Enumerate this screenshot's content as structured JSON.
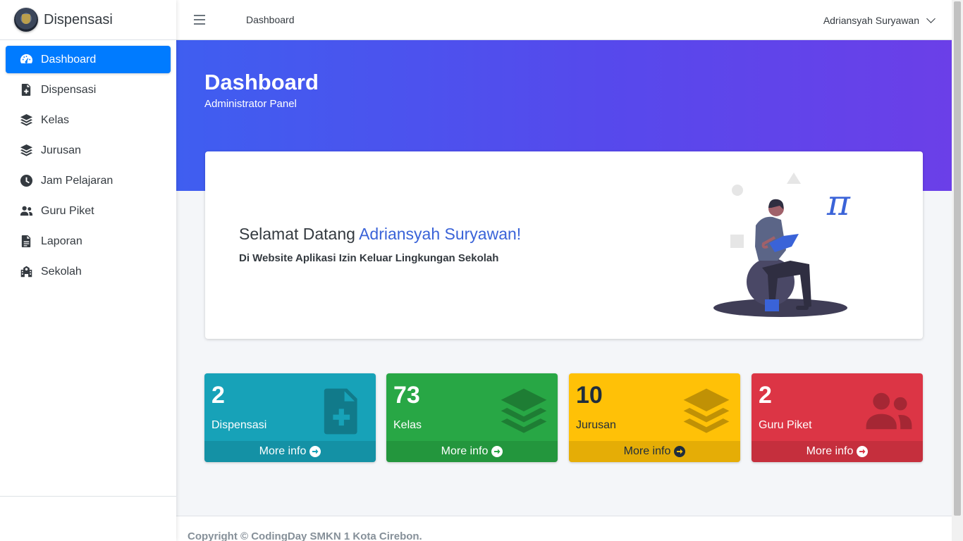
{
  "brand": {
    "name": "Dispensasi"
  },
  "sidebar": {
    "items": [
      {
        "label": "Dashboard",
        "icon": "tachometer-icon",
        "active": true
      },
      {
        "label": "Dispensasi",
        "icon": "file-medical-icon"
      },
      {
        "label": "Kelas",
        "icon": "layer-group-icon"
      },
      {
        "label": "Jurusan",
        "icon": "layer-group-icon"
      },
      {
        "label": "Jam Pelajaran",
        "icon": "clock-icon"
      },
      {
        "label": "Guru Piket",
        "icon": "users-icon"
      },
      {
        "label": "Laporan",
        "icon": "file-alt-icon"
      },
      {
        "label": "Sekolah",
        "icon": "school-icon"
      }
    ]
  },
  "header": {
    "title": "Dashboard",
    "user": "Adriansyah Suryawan"
  },
  "hero": {
    "title": "Dashboard",
    "subtitle": "Administrator Panel"
  },
  "welcome": {
    "greeting": "Selamat Datang",
    "name": "Adriansyah Suryawan!",
    "subtitle": "Di Website Aplikasi Izin Keluar Lingkungan Sekolah"
  },
  "stats": [
    {
      "value": "2",
      "label": "Dispensasi",
      "footer": "More info",
      "color": "#17a2b8",
      "icon": "file-medical-icon"
    },
    {
      "value": "73",
      "label": "Kelas",
      "footer": "More info",
      "color": "#28a745",
      "icon": "layer-group-icon"
    },
    {
      "value": "10",
      "label": "Jurusan",
      "footer": "More info",
      "color": "#ffc107",
      "icon": "layer-group-icon"
    },
    {
      "value": "2",
      "label": "Guru Piket",
      "footer": "More info",
      "color": "#dc3545",
      "icon": "users-icon"
    }
  ],
  "footer": {
    "text": "Copyright © CodingDay SMKN 1 Kota Cirebon."
  },
  "colors": {
    "accent": "#007bff",
    "hero_start": "#3f5ef0",
    "hero_end": "#6b3fe8"
  }
}
